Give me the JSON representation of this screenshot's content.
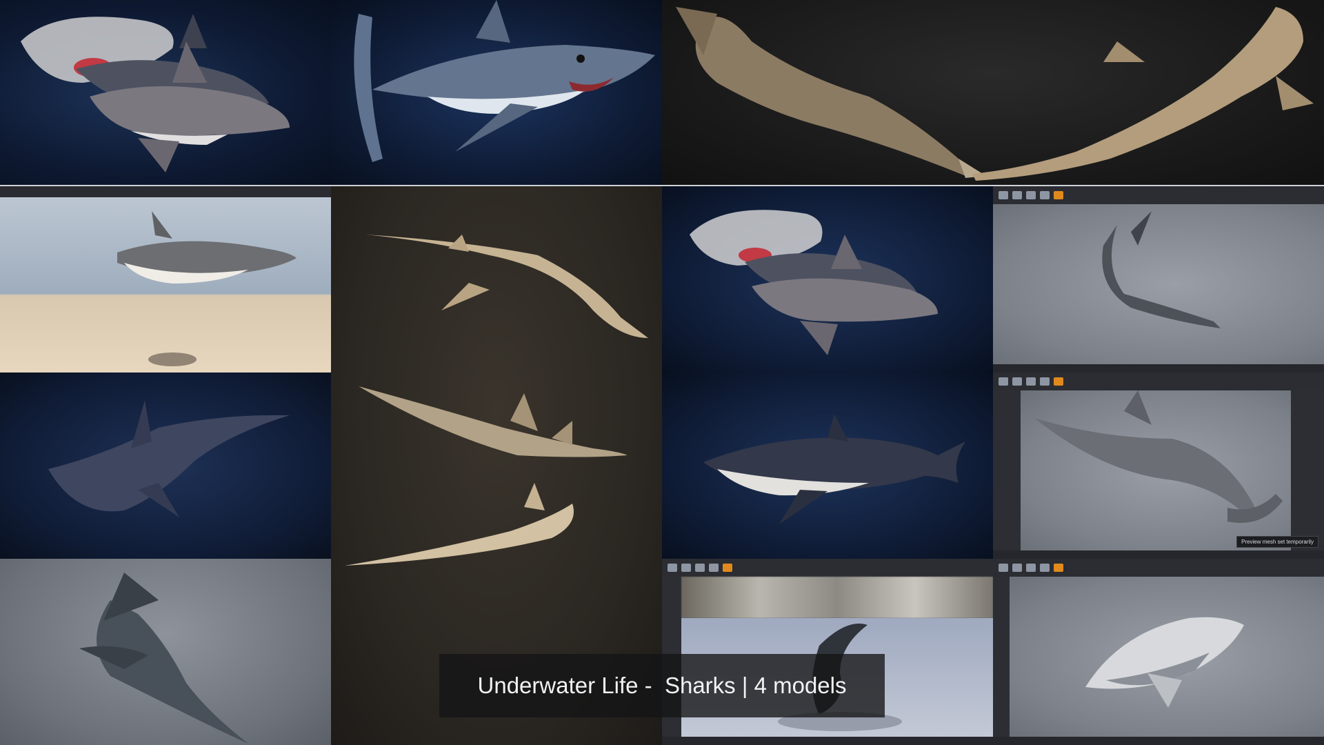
{
  "caption": {
    "text": "Underwater Life -  Sharks | 4 models"
  },
  "editor": {
    "toast": "Preview mesh set temporarily"
  },
  "icons": {
    "shark": "shark-icon",
    "sawfish": "sawfish-icon",
    "hammerhead": "hammerhead-icon"
  },
  "colors": {
    "ocean": "#0f1c36",
    "ue_accent": "#e08a1e",
    "caption_bg": "#141416"
  }
}
